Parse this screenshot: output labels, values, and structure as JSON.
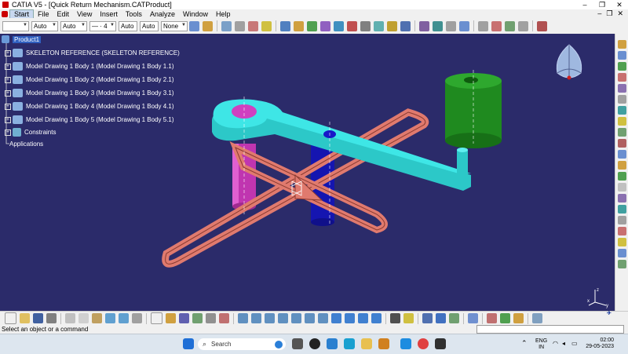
{
  "window": {
    "title": "CATIA V5 - [Quick Return Mechanism.CATProduct]",
    "controls": [
      "–",
      "❐",
      "✕"
    ]
  },
  "menubar": {
    "items": [
      "Start",
      "File",
      "Edit",
      "View",
      "Insert",
      "Tools",
      "Analyze",
      "Window",
      "Help"
    ],
    "mdi_controls": [
      "–",
      "❐",
      "✕"
    ]
  },
  "toolbar_top": {
    "color_combo": "",
    "linetype_combo1": "Auto",
    "linetype_combo2": "Auto",
    "line_width_combo": "— · 4",
    "auto_combo": "Auto",
    "auto_combo2": "Auto",
    "none_combo": "None"
  },
  "tree": {
    "root": "Product1",
    "items": [
      "SKELETON REFERENCE (SKELETON REFERENCE)",
      "Model Drawing 1 Body 1 (Model Drawing 1 Body 1.1)",
      "Model Drawing 1 Body 2 (Model Drawing 1 Body 2.1)",
      "Model Drawing 1 Body 3 (Model Drawing 1 Body 3.1)",
      "Model Drawing 1 Body 4 (Model Drawing 1 Body 4.1)",
      "Model Drawing 1 Body 5 (Model Drawing 1 Body 5.1)",
      "Constraints",
      "Applications"
    ]
  },
  "compass": {
    "axis_z": "z",
    "axis_x": "x",
    "axis_y": "y"
  },
  "status": {
    "message": "Select an object or a command"
  },
  "taskbar": {
    "search_placeholder": "Search",
    "language_line1": "ENG",
    "language_line2": "IN",
    "time": "02:00",
    "date": "29-05-2023"
  },
  "colors": {
    "viewport_bg": "#2b2b6a",
    "cyan_part": "#3ee6e6",
    "salmon_part": "#e07a6e",
    "green_part": "#1f8a1f",
    "magenta_part": "#d040c0",
    "blue_part": "#1818c8"
  }
}
